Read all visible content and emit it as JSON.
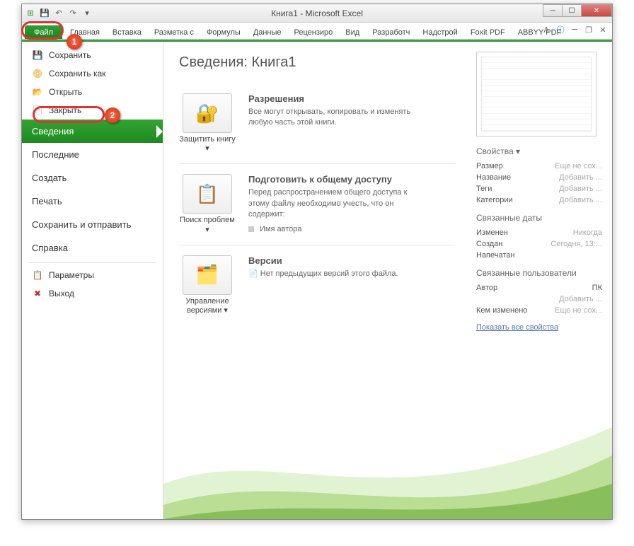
{
  "window": {
    "title": "Книга1 - Microsoft Excel"
  },
  "tabs": {
    "file": "Файл",
    "items": [
      "Главная",
      "Вставка",
      "Разметка с",
      "Формулы",
      "Данные",
      "Рецензиро",
      "Вид",
      "Разработч",
      "Надстрой",
      "Foxit PDF",
      "ABBYY PDF"
    ]
  },
  "sidebar": {
    "save": "Сохранить",
    "saveAs": "Сохранить как",
    "open": "Открыть",
    "close": "Закрыть",
    "info": "Сведения",
    "recent": "Последние",
    "new": "Создать",
    "print": "Печать",
    "saveSend": "Сохранить и отправить",
    "help": "Справка",
    "options": "Параметры",
    "exit": "Выход"
  },
  "details": {
    "title": "Сведения: Книга1",
    "permissions": {
      "btn": "Защитить книгу",
      "heading": "Разрешения",
      "text": "Все могут открывать, копировать и изменять любую часть этой книги."
    },
    "prepare": {
      "btn": "Поиск проблем",
      "heading": "Подготовить к общему доступу",
      "text": "Перед распространением общего доступа к этому файлу необходимо учесть, что он содержит:",
      "item1": "Имя автора"
    },
    "versions": {
      "btn": "Управление версиями",
      "heading": "Версии",
      "text": "Нет предыдущих версий этого файла."
    }
  },
  "props": {
    "header1": "Свойства",
    "size": "Размер",
    "sizeVal": "Еще не сох...",
    "name": "Название",
    "nameVal": "Добавить ...",
    "tags": "Теги",
    "tagsVal": "Добавить ...",
    "cats": "Категории",
    "catsVal": "Добавить ...",
    "header2": "Связанные даты",
    "modified": "Изменен",
    "modifiedVal": "Никогда",
    "created": "Создан",
    "createdVal": "Сегодня, 13:...",
    "printed": "Напечатан",
    "printedVal": "",
    "header3": "Связанные пользователи",
    "author": "Автор",
    "authorVal": "ПК",
    "addAuthor": "Добавить ...",
    "changedBy": "Кем изменено",
    "changedByVal": "Еще не сох...",
    "showAll": "Показать все свойства"
  },
  "annotations": {
    "b1": "1",
    "b2": "2"
  }
}
